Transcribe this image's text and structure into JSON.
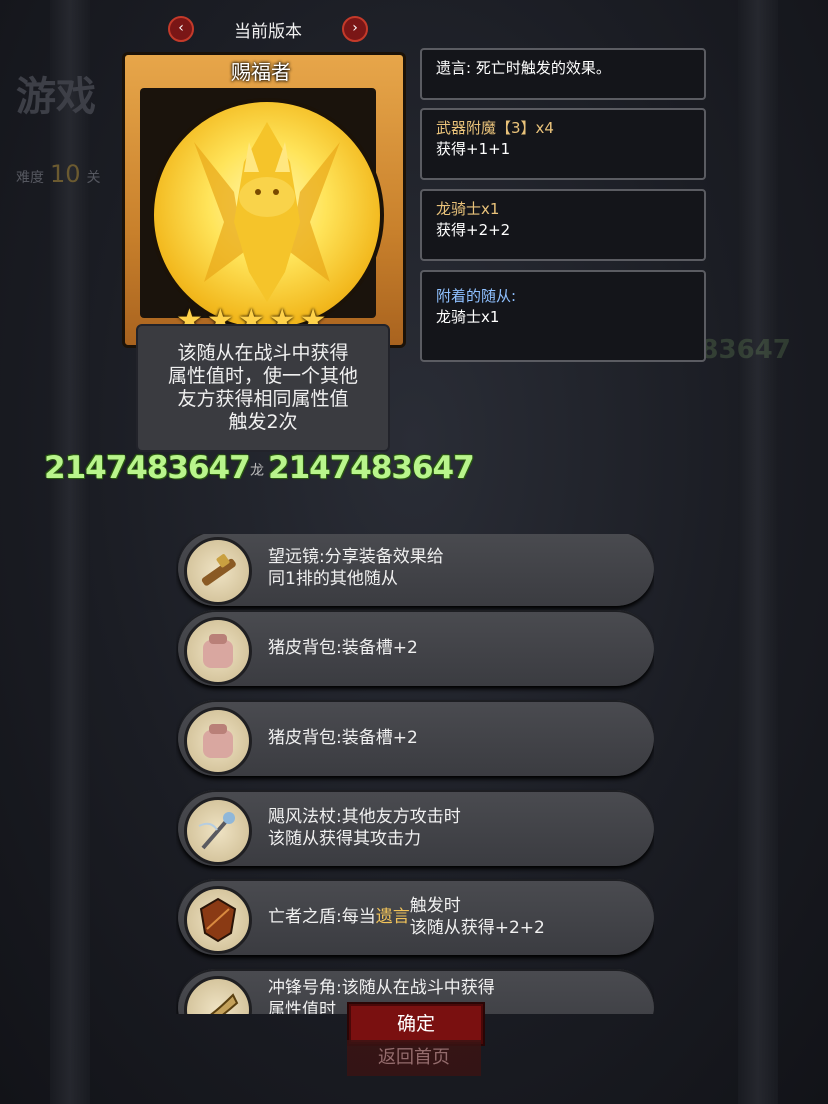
{
  "background": {
    "title": "游戏",
    "difficulty_label": "难度",
    "difficulty_value": "10",
    "level_label": "关",
    "ghost_number": "2147483647 2147483647"
  },
  "version_bar": {
    "label": "当前版本",
    "prev_icon": "chevron-left-icon",
    "next_icon": "chevron-right-icon"
  },
  "card": {
    "name": "赐福者",
    "stars": 5,
    "star_icon": "star-icon",
    "description": "该随从在战斗中获得\n属性值时，使一个其他\n友方获得相同属性值\n触发2次",
    "attack": "2147483647",
    "tribe": "龙",
    "health": "2147483647",
    "colors": {
      "frame": "#d48f36",
      "stat": "#b9f58c"
    }
  },
  "tooltips": [
    {
      "line1": "遗言: 死亡时触发的效果。",
      "line2": ""
    },
    {
      "line1": "武器附魔【3】x4",
      "line2": "获得+1+1"
    },
    {
      "line1": "龙骑士x1",
      "line2": "获得+2+2"
    },
    {
      "line1": "附着的随从:",
      "line2": "龙骑士x1"
    }
  ],
  "equipment": [
    {
      "icon": "telescope-icon",
      "text": "望远镜:分享装备效果给\n同1排的其他随从"
    },
    {
      "icon": "pigskin-backpack-icon",
      "text": "猪皮背包:装备槽+2"
    },
    {
      "icon": "pigskin-backpack-icon",
      "text": "猪皮背包:装备槽+2"
    },
    {
      "icon": "gale-staff-icon",
      "text": "飓风法杖:其他友方攻击时\n该随从获得其攻击力"
    },
    {
      "icon": "shield-icon",
      "text_pre": "亡者之盾:每当",
      "text_hl": "遗言",
      "text_post": "触发时\n该随从获得+2+2"
    },
    {
      "icon": "war-horn-icon",
      "text": "冲锋号角:该随从在战斗中获得\n属性值时"
    }
  ],
  "buttons": {
    "confirm": "确定",
    "home": "返回首页"
  }
}
